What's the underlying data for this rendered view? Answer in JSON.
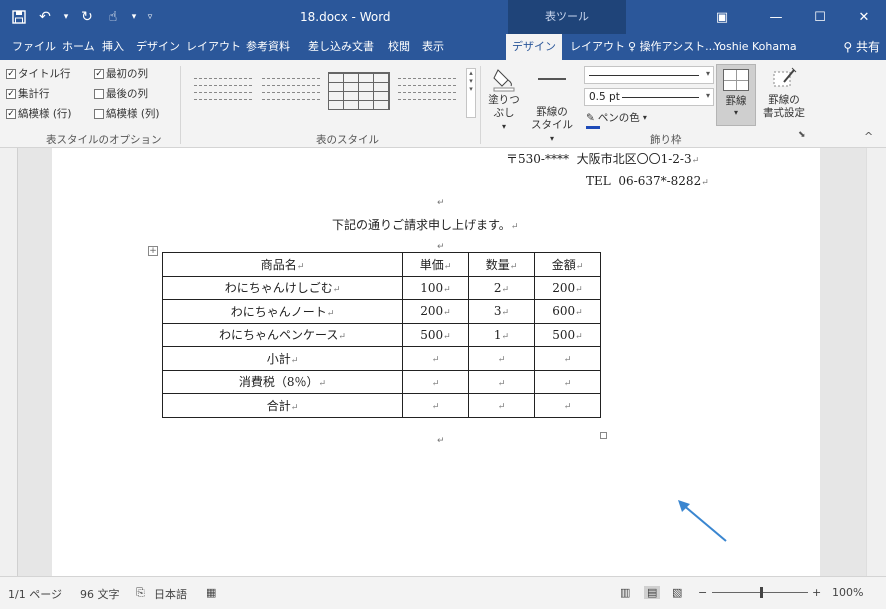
{
  "titlebar": {
    "document_title": "18.docx - Word",
    "context_tab": "表ツール",
    "icons": [
      "save-icon",
      "undo-icon",
      "redo-icon",
      "touch-mode-icon",
      "customize-qat-icon",
      "ribbon-display-icon",
      "minimize-icon",
      "maximize-icon",
      "close-icon"
    ]
  },
  "tabs": [
    {
      "label": "ファイル"
    },
    {
      "label": "ホーム"
    },
    {
      "label": "挿入"
    },
    {
      "label": "デザイン"
    },
    {
      "label": "レイアウト"
    },
    {
      "label": "参考資料"
    },
    {
      "label": "差し込み文書"
    },
    {
      "label": "校閲"
    },
    {
      "label": "表示"
    },
    {
      "label": "デザイン",
      "active": true
    },
    {
      "label": "レイアウト"
    },
    {
      "label": "操作アシスト..."
    },
    {
      "label": "Yoshie Kohama"
    }
  ],
  "share": {
    "label": "共有"
  },
  "ribbon": {
    "style_options": {
      "header_row": "タイトル行",
      "first_column": "最初の列",
      "total_row": "集計行",
      "last_column": "最後の列",
      "banded_rows": "縞模様 (行)",
      "banded_columns": "縞模様 (列)",
      "group_label": "表スタイルのオプション"
    },
    "table_styles": {
      "group_label": "表のスタイル"
    },
    "shading": {
      "label": "塗りつぶし"
    },
    "border_style": {
      "label1": "罫線の",
      "label2": "スタイル"
    },
    "line_weight": {
      "value": "0.5 pt"
    },
    "pen_color": {
      "label": "ペンの色",
      "color": "#1e4bb8"
    },
    "borders": {
      "label": "罫線"
    },
    "border_painter": {
      "label1": "罫線の",
      "label2": "書式設定"
    },
    "borders_group_label": "飾り枠"
  },
  "document": {
    "postal": "〒530-****",
    "address": "大阪市北区〇〇1-2-3",
    "tel_label": "TEL",
    "tel_number": "06-637*-8282",
    "intro": "下記の通りご請求申し上げます。",
    "paragraph_mark": "↵",
    "table": {
      "headers": [
        "商品名",
        "単価",
        "数量",
        "金額"
      ],
      "rows": [
        [
          "わにちゃんけしごむ",
          "100",
          "2",
          "200"
        ],
        [
          "わにちゃんノート",
          "200",
          "3",
          "600"
        ],
        [
          "わにちゃんペンケース",
          "500",
          "1",
          "500"
        ],
        [
          "小計",
          "",
          "",
          ""
        ],
        [
          "消費税（8％）",
          "",
          "",
          ""
        ],
        [
          "合計",
          "",
          "",
          ""
        ]
      ]
    }
  },
  "statusbar": {
    "page": "1/1 ページ",
    "words": "96 文字",
    "language": "日本語",
    "zoom": "100%"
  }
}
